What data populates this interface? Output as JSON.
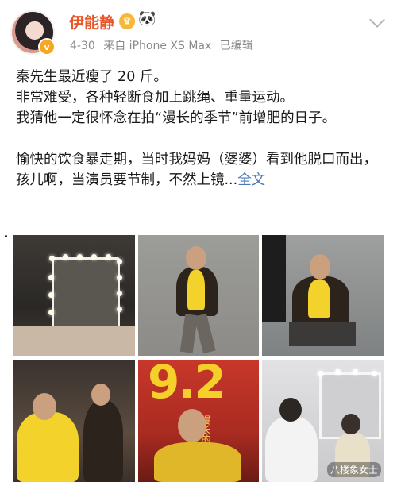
{
  "user": {
    "name": "伊能静",
    "badge_icon": "crown-badge-icon",
    "emoji_icon": "panda-icon",
    "verified_mark": "v"
  },
  "meta": {
    "date": "4-30",
    "source": "来自 iPhone XS Max",
    "edited": "已编辑"
  },
  "post": {
    "lines": [
      "秦先生最近瘦了 20 斤。",
      "非常难受，各种轻断食加上跳绳、重量运动。",
      "我猜他一定很怀念在拍“漫长的季节”前增肥的日子。",
      "愉快的饮食暴走期，当时我妈妈（婆婆）看到他脱口而出，孩儿啊，当演员要节制，不然上镜..."
    ],
    "full_text_link": "全文"
  },
  "photos": {
    "poster_big_text": "9.2",
    "poster_small_text": "漫长的季节",
    "watermark": "八楼象女士"
  },
  "colors": {
    "username": "#e8562a",
    "meta_gray": "#8a8a8a",
    "link_blue": "#4b79b8"
  }
}
